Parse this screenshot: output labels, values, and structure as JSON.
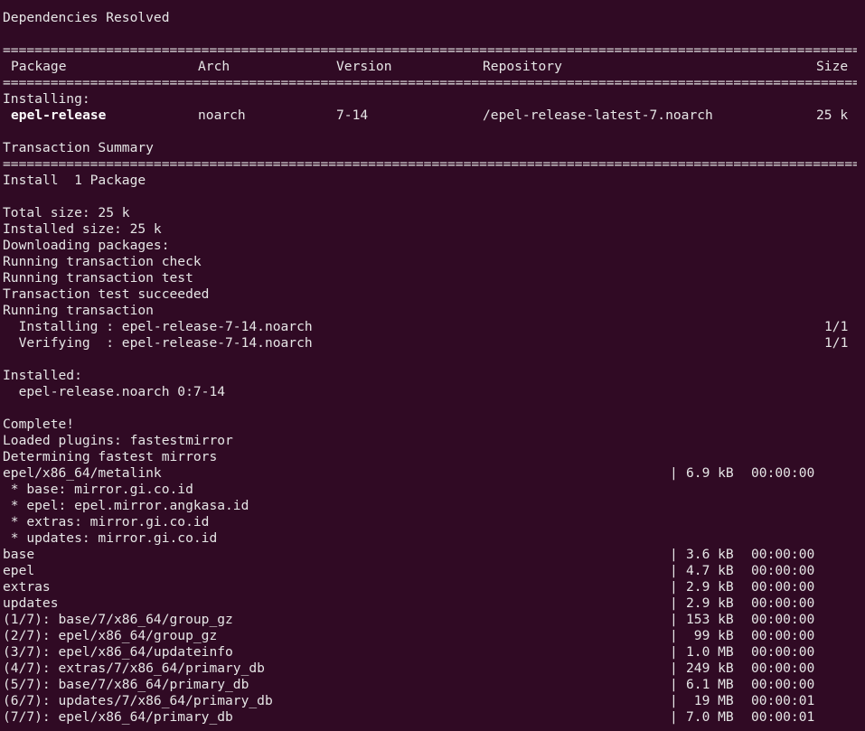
{
  "header": {
    "deps_resolved": "Dependencies Resolved"
  },
  "sep": "==========================================================================================================================================",
  "table": {
    "headers": [
      "Package",
      "Arch",
      "Version",
      "Repository",
      "Size"
    ],
    "section_label": "Installing:",
    "row": [
      "epel-release",
      "noarch",
      "7-14",
      "/epel-release-latest-7.noarch",
      "25 k"
    ]
  },
  "summary": {
    "title": "Transaction Summary",
    "install_line": "Install  1 Package",
    "total_size": "Total size: 25 k",
    "installed_size": "Installed size: 25 k",
    "downloading": "Downloading packages:",
    "check": "Running transaction check",
    "test": "Running transaction test",
    "test_ok": "Transaction test succeeded",
    "running": "Running transaction",
    "steps": [
      {
        "text": "  Installing : epel-release-7-14.noarch",
        "count": "1/1"
      },
      {
        "text": "  Verifying  : epel-release-7-14.noarch",
        "count": "1/1"
      }
    ],
    "installed_label": "Installed:",
    "installed_pkg": "  epel-release.noarch 0:7-14",
    "complete": "Complete!"
  },
  "yum": {
    "plugins": "Loaded plugins: fastestmirror",
    "determining": "Determining fastest mirrors",
    "metalink": {
      "name": "epel/x86_64/metalink",
      "size": "6.9 kB",
      "time": "00:00:00"
    },
    "mirrors": [
      " * base: mirror.gi.co.id",
      " * epel: epel.mirror.angkasa.id",
      " * extras: mirror.gi.co.id",
      " * updates: mirror.gi.co.id"
    ],
    "repos": [
      {
        "name": "base",
        "size": "3.6 kB",
        "time": "00:00:00"
      },
      {
        "name": "epel",
        "size": "4.7 kB",
        "time": "00:00:00"
      },
      {
        "name": "extras",
        "size": "2.9 kB",
        "time": "00:00:00"
      },
      {
        "name": "updates",
        "size": "2.9 kB",
        "time": "00:00:00"
      },
      {
        "name": "(1/7): base/7/x86_64/group_gz",
        "size": "153 kB",
        "time": "00:00:00"
      },
      {
        "name": "(2/7): epel/x86_64/group_gz",
        "size": " 99 kB",
        "time": "00:00:00"
      },
      {
        "name": "(3/7): epel/x86_64/updateinfo",
        "size": "1.0 MB",
        "time": "00:00:00"
      },
      {
        "name": "(4/7): extras/7/x86_64/primary_db",
        "size": "249 kB",
        "time": "00:00:00"
      },
      {
        "name": "(5/7): base/7/x86_64/primary_db",
        "size": "6.1 MB",
        "time": "00:00:00"
      },
      {
        "name": "(6/7): updates/7/x86_64/primary_db",
        "size": " 19 MB",
        "time": "00:00:01"
      },
      {
        "name": "(7/7): epel/x86_64/primary_db",
        "size": "7.0 MB",
        "time": "00:00:01"
      }
    ],
    "bar": "|"
  }
}
